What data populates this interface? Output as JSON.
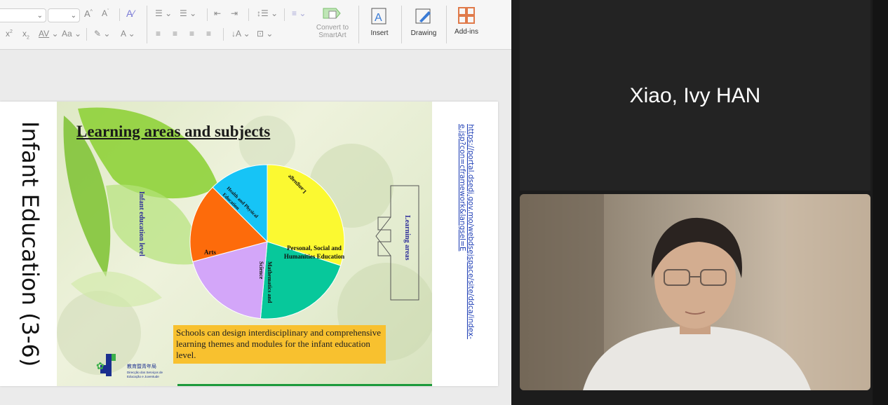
{
  "ribbon": {
    "insert_label": "Insert",
    "drawing_label": "Drawing",
    "addins_label": "Add-ins",
    "smartart_line1": "Convert to",
    "smartart_line2": "SmartArt",
    "char_spacing_label": "AV",
    "change_case_label": "Aa",
    "font_color_label": "A"
  },
  "slide": {
    "side_title": "Infant Education (3-6)",
    "heading": "Learning areas and subjects",
    "level_label": "Infant education level",
    "areas_label": "Learning areas",
    "pie": {
      "slices": [
        {
          "label": "Language",
          "color": "#fbf931"
        },
        {
          "label": "Personal, Social and Humanities Education",
          "color": "#07c89b"
        },
        {
          "label": "Mathematics and Science",
          "color": "#d3a6f9"
        },
        {
          "label": "Arts",
          "color": "#fd6b0b"
        },
        {
          "label": "Health and Physical Education",
          "color": "#16c4f6"
        }
      ],
      "label_personal_1": "Personal, Social and",
      "label_personal_2": "Humanities Education",
      "label_math_1": "Mathematics and",
      "label_math_2": "Science",
      "label_health_1": "Health and Physical",
      "label_health_2": "Education"
    },
    "callout": "Schools can design interdisciplinary and comprehensive learning themes and modules for the infant education level.",
    "logo_chinese": "教育暨青年局",
    "logo_portuguese_1": "Direcção dos Serviços de",
    "logo_portuguese_2": "Educação e Juventude",
    "url_line1": "https://portal.dsedj.gov.mo/webdsejspace/site/ddca/index-",
    "url_line2": "e.jsp?con=cframework&langsel=E"
  },
  "video": {
    "participant_name": "Xiao, Ivy HAN"
  }
}
